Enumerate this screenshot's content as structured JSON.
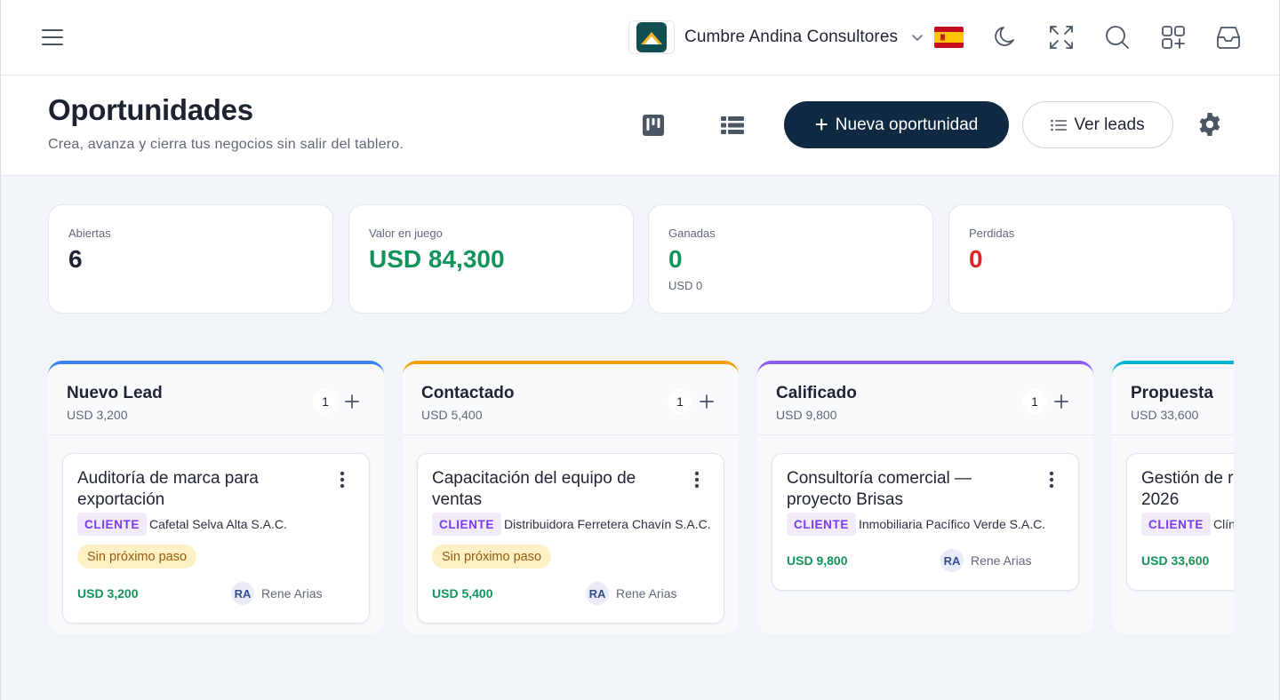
{
  "topbar": {
    "org_name": "Cumbre Andina Consultores",
    "icons": [
      "menu-icon",
      "chevron-down-icon",
      "flag-es-icon",
      "moon-icon",
      "fullscreen-icon",
      "search-icon",
      "apps-add-icon",
      "inbox-icon"
    ]
  },
  "header": {
    "title": "Oportunidades",
    "subtitle": "Crea, avanza y cierra tus negocios sin salir del tablero.",
    "new_button_label": "Nueva oportunidad",
    "leads_button_label": "Ver leads"
  },
  "stats": [
    {
      "label": "Abiertas",
      "value": "6",
      "foot": "",
      "color": "#1f2433"
    },
    {
      "label": "Valor en juego",
      "value": "USD 84,300",
      "foot": "",
      "color": "#11935a"
    },
    {
      "label": "Ganadas",
      "value": "0",
      "foot": "USD 0",
      "color": "#11935a"
    },
    {
      "label": "Perdidas",
      "value": "0",
      "foot": "",
      "color": "#dc2626"
    }
  ],
  "columns": [
    {
      "title": "Nuevo Lead",
      "total": "USD 3,200",
      "count": "1",
      "accent": "#3b82f6",
      "card": {
        "title": "Auditoría de marca para exportación",
        "tag": "CLIENTE",
        "company": "Cafetal Selva Alta S.A.C.",
        "next_step": "Sin próximo paso",
        "amount": "USD 3,200",
        "owner_initials": "RA",
        "owner_name": "Rene Arias"
      }
    },
    {
      "title": "Contactado",
      "total": "USD 5,400",
      "count": "1",
      "accent": "#f59e0b",
      "card": {
        "title": "Capacitación del equipo de ventas",
        "tag": "CLIENTE",
        "company": "Distribuidora Ferretera Chavín S.A.C.",
        "next_step": "Sin próximo paso",
        "amount": "USD 5,400",
        "owner_initials": "RA",
        "owner_name": "Rene Arias"
      }
    },
    {
      "title": "Calificado",
      "total": "USD 9,800",
      "count": "1",
      "accent": "#8b5cf6",
      "card": {
        "title": "Consultoría comercial — proyecto Brisas",
        "tag": "CLIENTE",
        "company": "Inmobiliaria Pacífico Verde S.A.C.",
        "next_step": "",
        "amount": "USD 9,800",
        "owner_initials": "RA",
        "owner_name": "Rene Arias"
      }
    },
    {
      "title": "Propuesta",
      "total": "USD 33,600",
      "count": "",
      "accent": "#06b6d4",
      "card": {
        "title": "Gestión de r 2026",
        "tag": "CLIENTE",
        "company": "Clín",
        "next_step": "",
        "amount": "USD 33,600",
        "owner_initials": "",
        "owner_name": ""
      }
    }
  ]
}
